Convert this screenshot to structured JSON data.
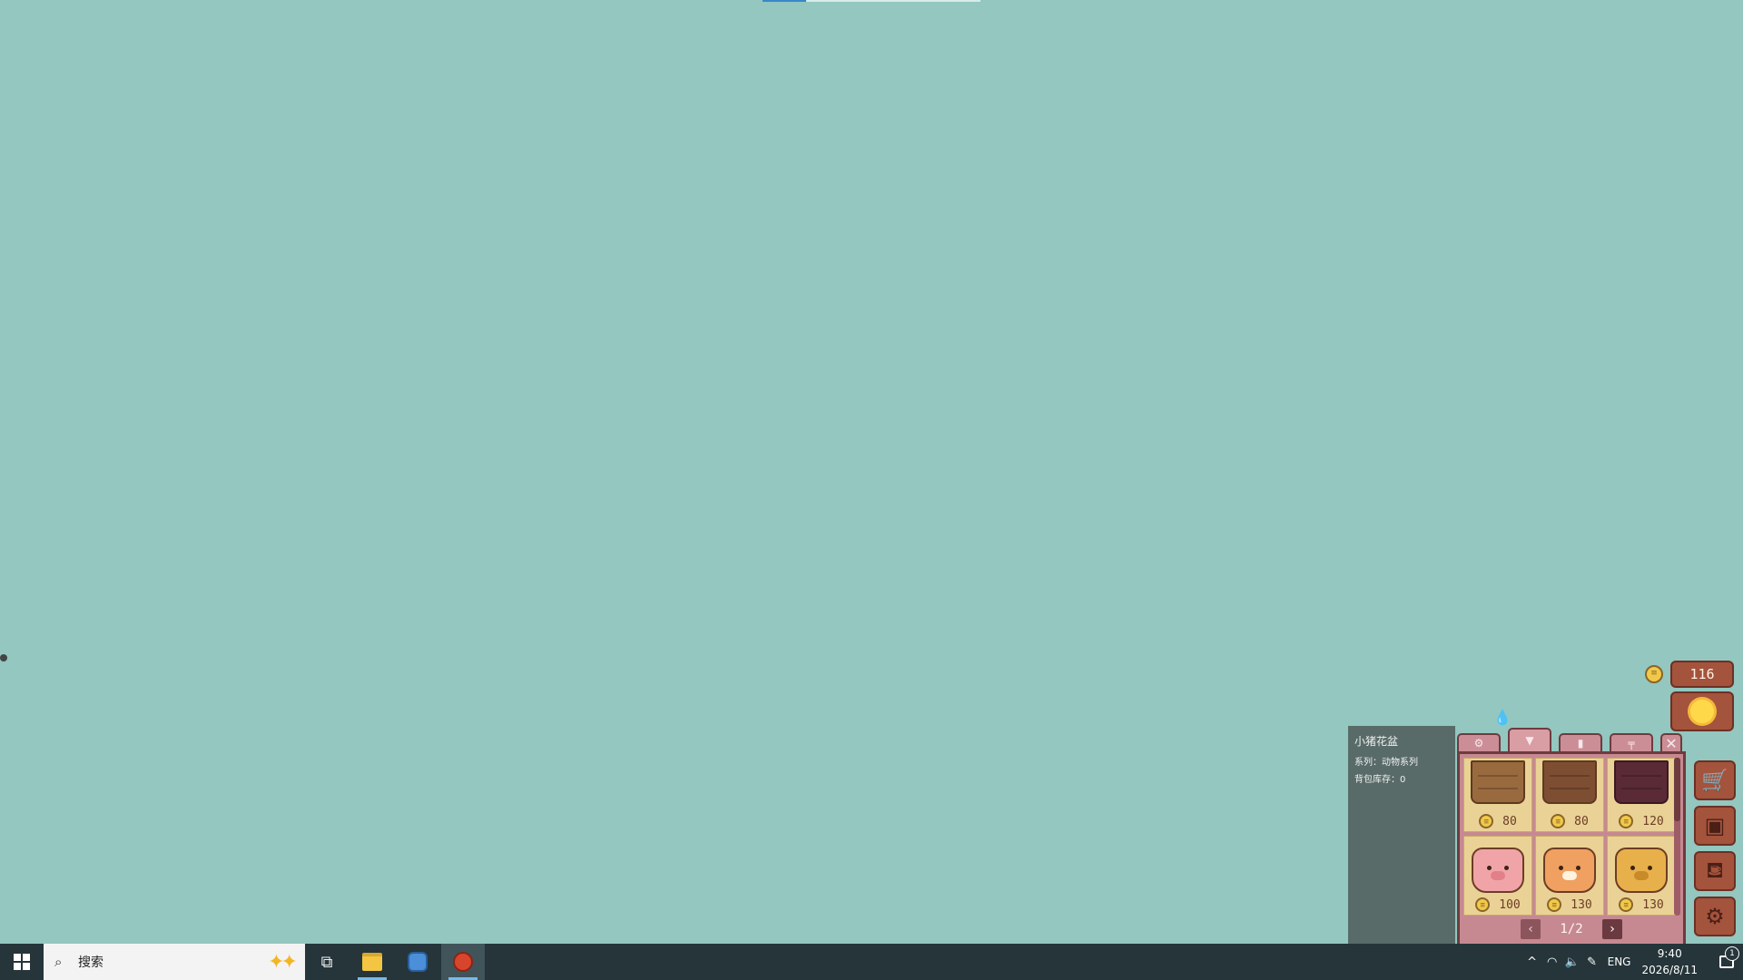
{
  "top_progress": {
    "percent": 20
  },
  "shop": {
    "coins": "116",
    "tooltip": {
      "name": "小猪花盆",
      "series": "系列：动物系列",
      "stock": "背包库存：0"
    },
    "tabs": [
      {
        "icon": "gear-icon",
        "glyph": "⚙"
      },
      {
        "icon": "pot-icon",
        "glyph": "▼"
      },
      {
        "icon": "trash-icon",
        "glyph": "▮"
      },
      {
        "icon": "table-icon",
        "glyph": "╤"
      }
    ],
    "close_glyph": "✕",
    "items": [
      {
        "name": "wood-pot",
        "price": "80"
      },
      {
        "name": "dark-wood-pot",
        "price": "80"
      },
      {
        "name": "plum-pot",
        "price": "120"
      },
      {
        "name": "pig-pot",
        "price": "100"
      },
      {
        "name": "cat-pot",
        "price": "130"
      },
      {
        "name": "dog-pot",
        "price": "130"
      }
    ],
    "pager": {
      "prev": "‹",
      "label": "1/2",
      "next": "›"
    },
    "side_buttons": [
      {
        "icon": "shop-cart-icon",
        "glyph": "🛒"
      },
      {
        "icon": "backpack-icon",
        "glyph": "▣"
      },
      {
        "icon": "watering-can-icon",
        "glyph": "⛾"
      },
      {
        "icon": "settings-gear-icon",
        "glyph": "⚙"
      }
    ]
  },
  "taskbar": {
    "search_placeholder": "搜索",
    "lang": "ENG",
    "time": "9:40",
    "date": "2026/8/11",
    "notification_count": "1"
  }
}
